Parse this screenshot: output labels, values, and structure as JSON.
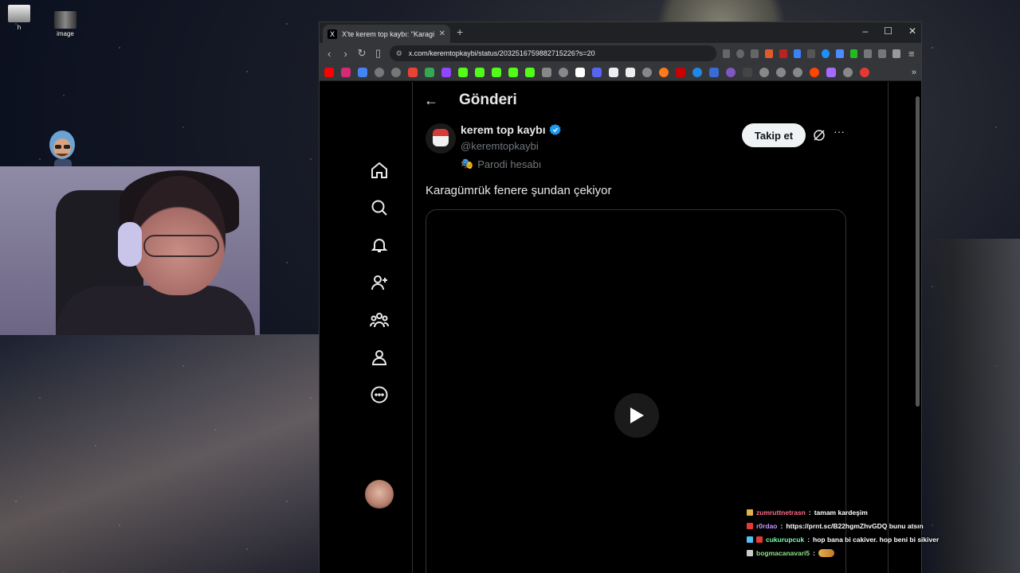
{
  "desktop": {
    "icons": [
      {
        "label": "h"
      },
      {
        "label": "image"
      }
    ]
  },
  "browser": {
    "tab_title": "X'te kerem top kaybı: \"Karagümr",
    "tab_favicon": "X",
    "url": "x.com/keremtopkaybi/status/2032516759882715226?s=20",
    "window_controls": [
      "–",
      "☐",
      "✕"
    ]
  },
  "x": {
    "page_title": "Gönderi",
    "nav_items": [
      "home-icon",
      "search-icon",
      "notifications-icon",
      "follow-icon",
      "communities-icon",
      "profile-icon",
      "more-icon"
    ],
    "author": {
      "name": "kerem top kaybı",
      "handle": "@keremtopkaybi",
      "label_badge": "Parodi hesabı",
      "verified_color": "#1d9bf0"
    },
    "follow_label": "Takip et",
    "more_label": "···",
    "tweet_text": "Karagümrük fenere şundan çekiyor"
  },
  "chat": {
    "messages": [
      {
        "user": "zumruttnetrasn",
        "text": "tamam kardeşim",
        "color": "#ff6b8a"
      },
      {
        "user": "r0rdao",
        "text": "https://prnt.sc/B22hgmZhvGDQ bunu atsın",
        "color": "#c59bff"
      },
      {
        "user": "cukurupcuk",
        "text": "hop bana bi cakiver. hop beni bi sikiver",
        "color": "#7cffb2"
      },
      {
        "user": "bogmacanavari5",
        "text": "",
        "color": "#8fe388"
      }
    ]
  }
}
